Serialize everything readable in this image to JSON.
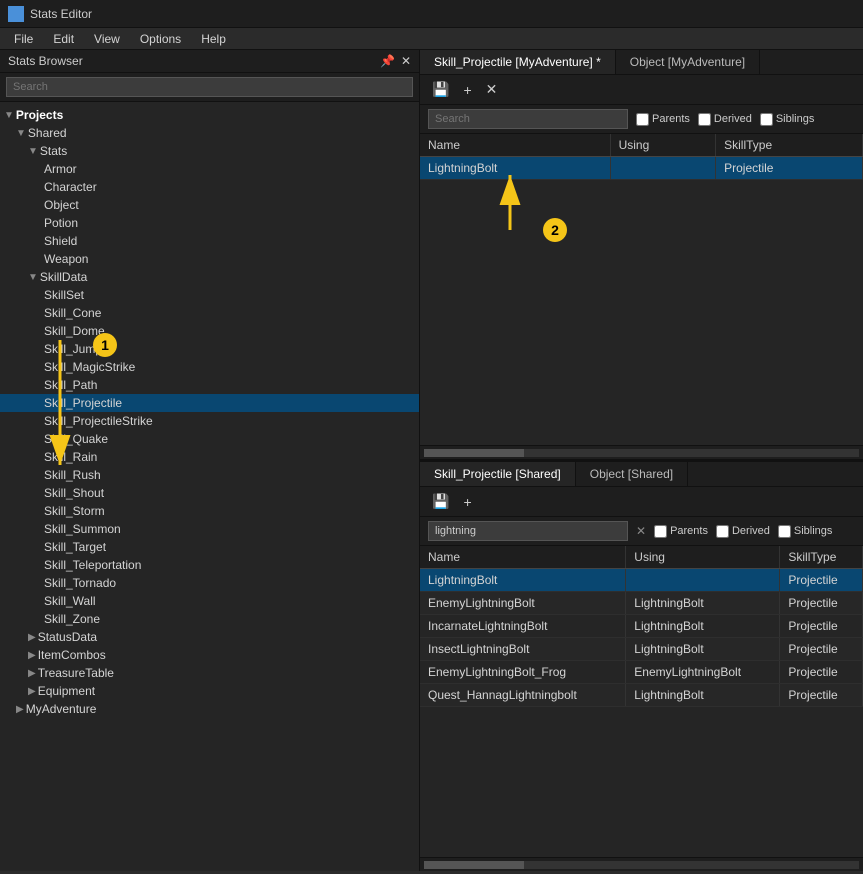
{
  "titleBar": {
    "icon": "stats-icon",
    "title": "Stats Editor"
  },
  "menuBar": {
    "items": [
      "File",
      "Edit",
      "View",
      "Options",
      "Help"
    ]
  },
  "leftPanel": {
    "title": "Stats Browser",
    "searchPlaceholder": "Search",
    "tree": {
      "projects": {
        "label": "Projects",
        "children": {
          "shared": {
            "label": "Shared",
            "children": {
              "stats": {
                "label": "Stats",
                "children": [
                  "Armor",
                  "Character",
                  "Object",
                  "Potion",
                  "Shield",
                  "Weapon"
                ]
              },
              "skillData": {
                "label": "SkillData",
                "children": [
                  "SkillSet",
                  "Skill_Cone",
                  "Skill_Dome",
                  "Skill_Jump",
                  "Skill_MagicStrike",
                  "Skill_Path",
                  "Skill_Projectile",
                  "Skill_ProjectileStrike",
                  "Skill_Quake",
                  "Skill_Rain",
                  "Skill_Rush",
                  "Skill_Shout",
                  "Skill_Storm",
                  "Skill_Summon",
                  "Skill_Target",
                  "Skill_Teleportation",
                  "Skill_Tornado",
                  "Skill_Wall",
                  "Skill_Zone"
                ]
              },
              "statusData": {
                "label": "StatusData"
              },
              "itemCombos": {
                "label": "ItemCombos"
              },
              "treasureTable": {
                "label": "TreasureTable"
              },
              "equipment": {
                "label": "Equipment"
              }
            }
          },
          "myAdventure": {
            "label": "MyAdventure"
          }
        }
      }
    }
  },
  "rightPanel": {
    "topPane": {
      "tabs": [
        {
          "label": "Skill_Projectile [MyAdventure] *",
          "active": true
        },
        {
          "label": "Object [MyAdventure]",
          "active": false
        }
      ],
      "toolbar": {
        "saveBtn": "💾",
        "addBtn": "+",
        "closeBtn": "✕"
      },
      "searchPlaceholder": "Search",
      "checkboxes": [
        "Parents",
        "Derived",
        "Siblings"
      ],
      "columns": [
        "Name",
        "Using",
        "SkillType"
      ],
      "rows": [
        {
          "name": "LightningBolt",
          "using": "",
          "skillType": "Projectile"
        }
      ]
    },
    "bottomPane": {
      "tabs": [
        {
          "label": "Skill_Projectile [Shared]",
          "active": true
        },
        {
          "label": "Object [Shared]",
          "active": false
        }
      ],
      "toolbar": {
        "saveBtn": "💾",
        "addBtn": "+"
      },
      "searchValue": "lightning",
      "searchPlaceholder": "Search",
      "checkboxes": [
        "Parents",
        "Derived",
        "Siblings"
      ],
      "columns": [
        "Name",
        "Using",
        "SkillType"
      ],
      "rows": [
        {
          "name": "LightningBolt",
          "using": "",
          "skillType": "Projectile"
        },
        {
          "name": "EnemyLightningBolt",
          "using": "LightningBolt",
          "skillType": "Projectile"
        },
        {
          "name": "IncarnateLightningBolt",
          "using": "LightningBolt",
          "skillType": "Projectile"
        },
        {
          "name": "InsectLightningBolt",
          "using": "LightningBolt",
          "skillType": "Projectile"
        },
        {
          "name": "EnemyLightningBolt_Frog",
          "using": "EnemyLightningBolt",
          "skillType": "Projectile"
        },
        {
          "name": "Quest_HannagLightningbolt",
          "using": "LightningBolt",
          "skillType": "Projectile"
        }
      ]
    }
  },
  "annotations": {
    "arrow1Label": "1",
    "arrow2Label": "2"
  }
}
